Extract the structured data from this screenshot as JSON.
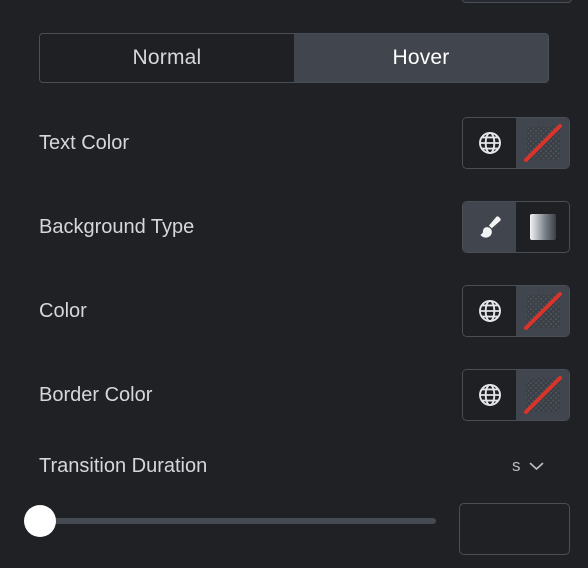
{
  "panel": {
    "background_color": "#1f2124",
    "accent_color": "#d9342b",
    "active_tab_color": "#41454d"
  },
  "top_cutoff": {
    "name": "partially-visible-control"
  },
  "tabs": {
    "name": "state-tabs",
    "items": [
      {
        "label": "Normal",
        "active": false
      },
      {
        "label": "Hover",
        "active": true
      }
    ]
  },
  "rows": [
    {
      "id": "text-color",
      "label": "Text Color",
      "control": "color-picker",
      "left_icon": "globe-icon",
      "left_selected": false,
      "swatch_value": "",
      "swatch_state": "no-color"
    },
    {
      "id": "background-type",
      "label": "Background Type",
      "control": "choice-toggle",
      "left_icon": "brush-icon",
      "left_selected": true,
      "right_icon": "gradient-icon",
      "right_selected": false
    },
    {
      "id": "color",
      "label": "Color",
      "control": "color-picker",
      "left_icon": "globe-icon",
      "left_selected": false,
      "swatch_value": "",
      "swatch_state": "no-color"
    },
    {
      "id": "border-color",
      "label": "Border Color",
      "control": "color-picker",
      "left_icon": "globe-icon",
      "left_selected": false,
      "swatch_value": "",
      "swatch_state": "no-color"
    }
  ],
  "transition_duration": {
    "label": "Transition Duration",
    "unit": "s",
    "unit_dropdown_icon": "chevron-down-icon",
    "slider": {
      "value": 0,
      "min": 0,
      "max": 100,
      "handle_position_percent": 0
    },
    "input_value": "",
    "input_placeholder": ""
  }
}
